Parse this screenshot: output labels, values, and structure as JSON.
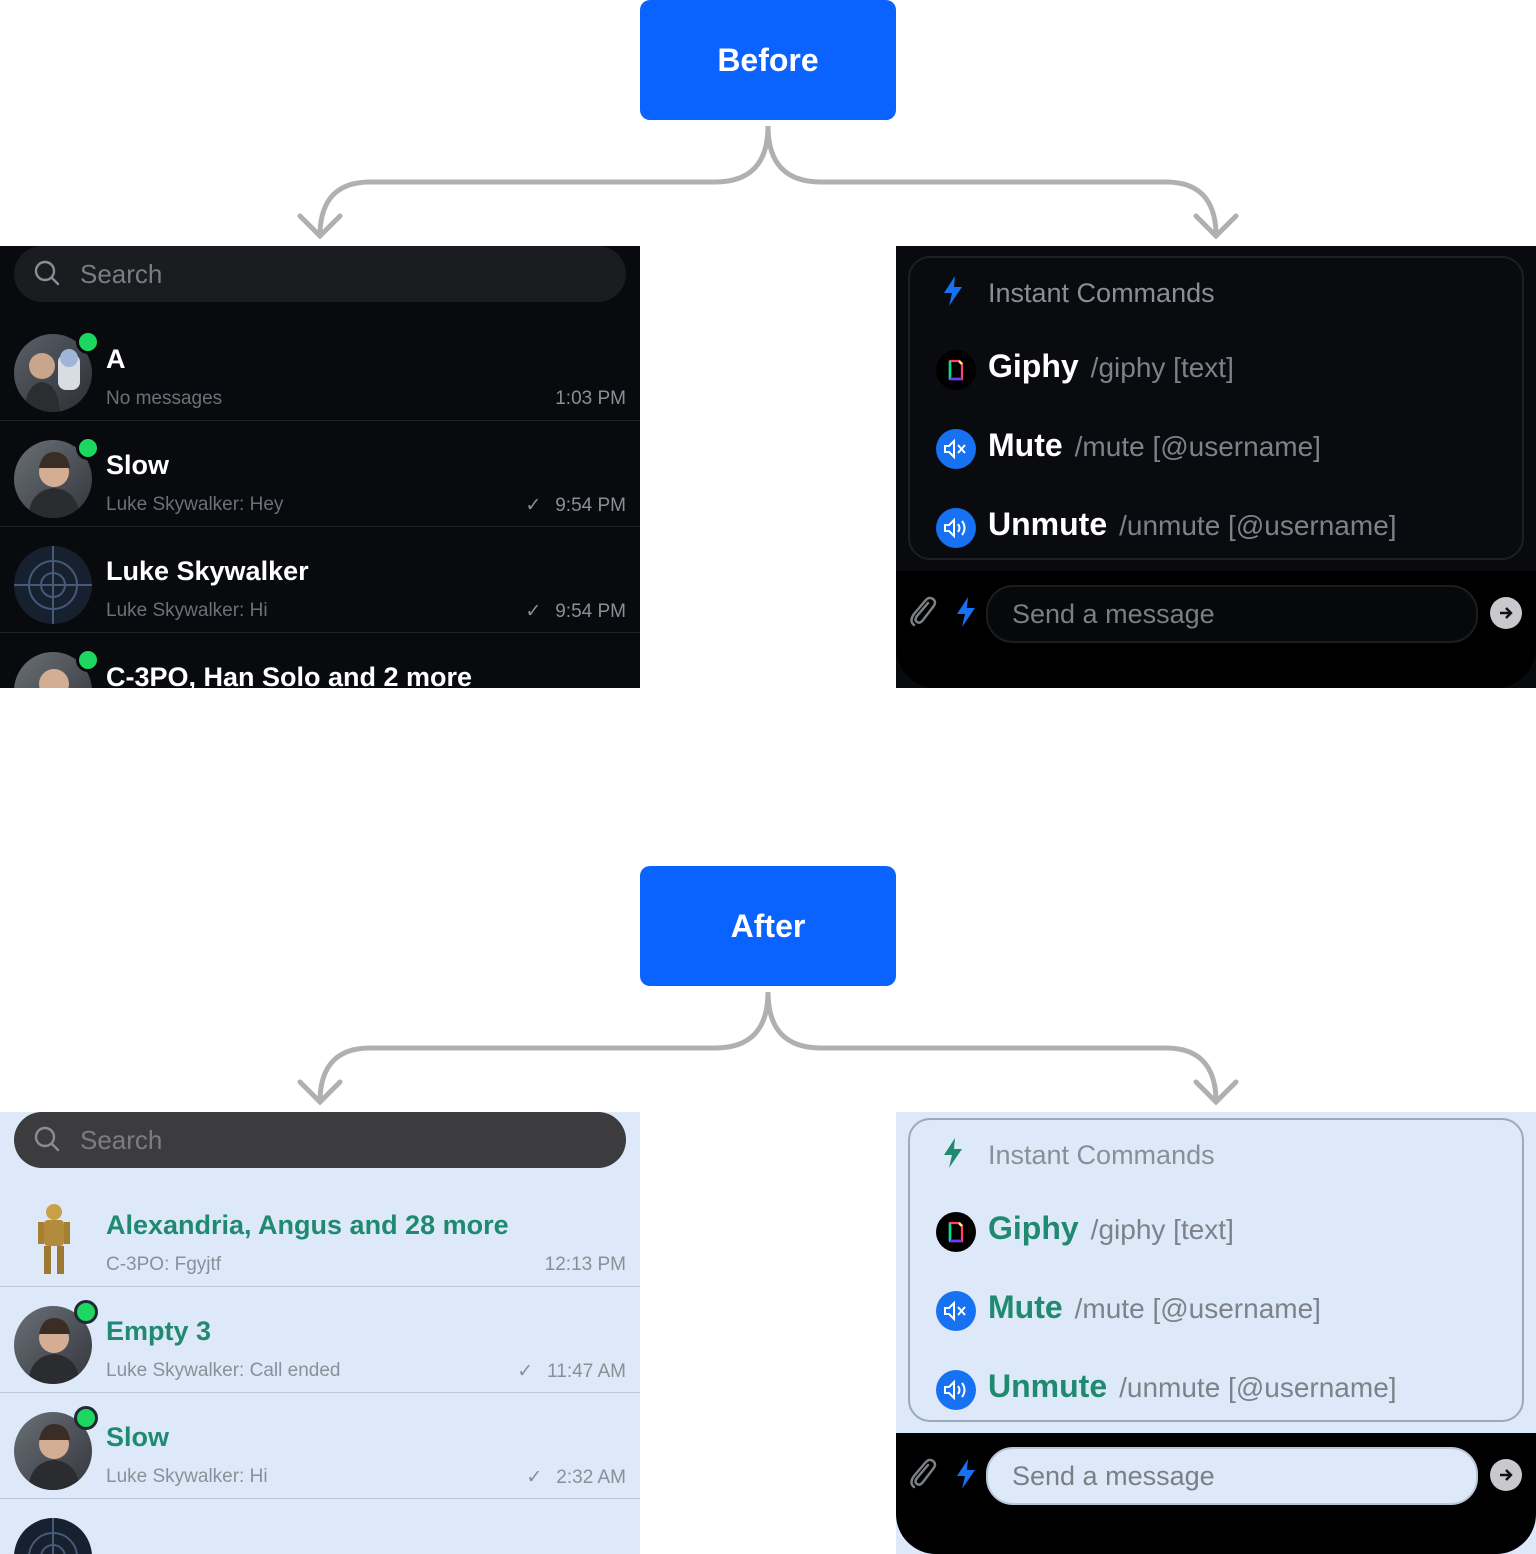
{
  "labels": {
    "before": "Before",
    "after": "After"
  },
  "colors": {
    "accent": "#0a62ff",
    "online": "#1ed760",
    "title_green": "#1f8a70"
  },
  "before": {
    "search_placeholder": "Search",
    "rows": [
      {
        "title": "A",
        "subtitle": "No messages",
        "time": "1:03 PM",
        "online": true,
        "read_check": false
      },
      {
        "title": "Slow",
        "subtitle": "Luke Skywalker: Hey",
        "time": "9:54 PM",
        "online": true,
        "read_check": true
      },
      {
        "title": "Luke Skywalker",
        "subtitle": "Luke Skywalker: Hi",
        "time": "9:54 PM",
        "online": false,
        "read_check": true
      },
      {
        "title": "C-3PO, Han Solo and 2 more",
        "subtitle": "",
        "time": "",
        "online": true,
        "read_check": false
      }
    ],
    "commands_header": "Instant Commands",
    "commands": [
      {
        "name": "Giphy",
        "args": "/giphy [text]",
        "icon": "giphy-icon"
      },
      {
        "name": "Mute",
        "args": "/mute [@username]",
        "icon": "mute-icon"
      },
      {
        "name": "Unmute",
        "args": "/unmute [@username]",
        "icon": "unmute-icon"
      }
    ],
    "message_placeholder": "Send a message"
  },
  "after": {
    "search_placeholder": "Search",
    "rows": [
      {
        "title": "Alexandria, Angus and 28 more",
        "subtitle": "C-3PO: Fgyjtf",
        "time": "12:13 PM",
        "online": false,
        "read_check": false
      },
      {
        "title": "Empty 3",
        "subtitle": "Luke Skywalker: Call ended",
        "time": "11:47 AM",
        "online": true,
        "read_check": true
      },
      {
        "title": "Slow",
        "subtitle": "Luke Skywalker: Hi",
        "time": "2:32 AM",
        "online": true,
        "read_check": true
      }
    ],
    "commands_header": "Instant Commands",
    "commands": [
      {
        "name": "Giphy",
        "args": "/giphy [text]",
        "icon": "giphy-icon"
      },
      {
        "name": "Mute",
        "args": "/mute [@username]",
        "icon": "mute-icon"
      },
      {
        "name": "Unmute",
        "args": "/unmute [@username]",
        "icon": "unmute-icon"
      }
    ],
    "message_placeholder": "Send a message"
  }
}
